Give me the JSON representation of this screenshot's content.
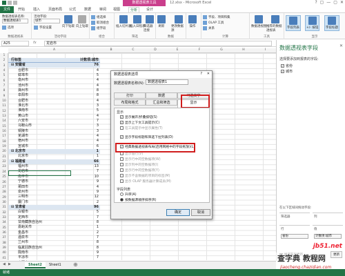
{
  "titlebar": {
    "context_tab": "数据透视表工具",
    "title": "12.xlsx - Microsoft Excel",
    "controls": [
      "?",
      "▢",
      "—",
      "▢",
      "✕"
    ]
  },
  "tabs": [
    "文件",
    "开始",
    "插入",
    "页面布局",
    "公式",
    "数据",
    "审阅",
    "视图",
    "分析",
    "设计"
  ],
  "active_tab": "分析",
  "ribbon": {
    "pivot_name_label": "数据透视表名称:",
    "pivot_name_value": "数据透视表1",
    "options_button": "选项",
    "active_field_label": "活动字段:",
    "active_field_value": "城市",
    "field_settings": "字段设置",
    "group_pivot": "数据透视表",
    "group_active_field": "活动字段",
    "drill_down": "向下钻取",
    "drill_up": "向上钻取",
    "group_selection": "组选择",
    "ungroup": "取消组合",
    "group_field": "组字段",
    "group_group": "组合",
    "insert_slicer": "插入切片器",
    "insert_timeline": "插入日程表",
    "filter_connections": "筛选器连接",
    "group_filter": "筛选",
    "refresh": "刷新",
    "change_source": "更改数据源",
    "group_data": "数据",
    "actions": "操作",
    "calc": "计算",
    "fields_items": "字段、项目和集",
    "olap_tools": "OLAP 工具",
    "relationships": "关系",
    "pivot_chart": "数据透视图",
    "recommended": "推荐的数据透视表",
    "group_tools": "工具",
    "field_list": "字段列表",
    "buttons": "+/- 按钮",
    "headers": "字段标题",
    "group_show": "显示"
  },
  "formula": {
    "namebox": "A25",
    "fx": "fx",
    "value": "龙岩市"
  },
  "columns": [
    "A",
    "B",
    "C",
    "D",
    "E",
    "F",
    "G",
    "H",
    "I"
  ],
  "rows": [
    "1",
    "2",
    "3",
    "4",
    "5",
    "6",
    "7",
    "8",
    "9",
    "10",
    "11",
    "12",
    "13",
    "14",
    "15",
    "16",
    "17",
    "18",
    "19",
    "20",
    "21",
    "22",
    "23",
    "24",
    "25",
    "26",
    "27",
    "28",
    "29",
    "30",
    "31",
    "32",
    "33",
    "34",
    "35",
    "36",
    "37",
    "38",
    "39",
    "40",
    "41"
  ],
  "pivot": {
    "header_label": "行标签",
    "header_value": "计数项:城市",
    "rows": [
      {
        "label": "安徽省",
        "value": "76",
        "type": "prov"
      },
      {
        "label": "合肥市",
        "value": "4",
        "type": "city"
      },
      {
        "label": "蚌埠市",
        "value": "5",
        "type": "city"
      },
      {
        "label": "亳州市",
        "value": "4",
        "type": "city"
      },
      {
        "label": "池州市",
        "value": "4",
        "type": "city"
      },
      {
        "label": "滁州市",
        "value": "8",
        "type": "city"
      },
      {
        "label": "阜阳市",
        "value": "8",
        "type": "city"
      },
      {
        "label": "合肥市",
        "value": "4",
        "type": "city"
      },
      {
        "label": "淮北市",
        "value": "3",
        "type": "city"
      },
      {
        "label": "淮南市",
        "value": "5",
        "type": "city"
      },
      {
        "label": "黄山市",
        "value": "4",
        "type": "city"
      },
      {
        "label": "六安市",
        "value": "7",
        "type": "city"
      },
      {
        "label": "马鞍山市",
        "value": "3",
        "type": "city"
      },
      {
        "label": "铜陵市",
        "value": "3",
        "type": "city"
      },
      {
        "label": "芜湖市",
        "value": "4",
        "type": "city"
      },
      {
        "label": "宿州市",
        "value": "4",
        "type": "city"
      },
      {
        "label": "宣城市",
        "value": "6",
        "type": "city"
      },
      {
        "label": "北京市",
        "value": "1",
        "type": "prov"
      },
      {
        "label": "北京市",
        "value": "1",
        "type": "city"
      },
      {
        "label": "福建省",
        "value": "66",
        "type": "prov"
      },
      {
        "label": "福州市",
        "value": "13",
        "type": "city"
      },
      {
        "label": "龙岩市",
        "value": "7",
        "type": "city"
      },
      {
        "label": "南平市",
        "value": "10",
        "type": "city"
      },
      {
        "label": "宁德市",
        "value": "9",
        "type": "city"
      },
      {
        "label": "莆田市",
        "value": "4",
        "type": "city"
      },
      {
        "label": "泉州市",
        "value": "9",
        "type": "city"
      },
      {
        "label": "三明市",
        "value": "12",
        "type": "city"
      },
      {
        "label": "厦门市",
        "value": "2",
        "type": "city"
      },
      {
        "label": "甘肃省",
        "value": "96",
        "type": "prov"
      },
      {
        "label": "白银市",
        "value": "5",
        "type": "city"
      },
      {
        "label": "定西市",
        "value": "7",
        "type": "city"
      },
      {
        "label": "甘南藏族自治州",
        "value": "8",
        "type": "city"
      },
      {
        "label": "嘉峪关市",
        "value": "1",
        "type": "city"
      },
      {
        "label": "金昌市",
        "value": "2",
        "type": "city"
      },
      {
        "label": "酒泉市",
        "value": "7",
        "type": "city"
      },
      {
        "label": "兰州市",
        "value": "8",
        "type": "city"
      },
      {
        "label": "临夏回族自治州",
        "value": "8",
        "type": "city"
      },
      {
        "label": "陇南市",
        "value": "9",
        "type": "city"
      },
      {
        "label": "平凉市",
        "value": "7",
        "type": "city"
      },
      {
        "label": "庆阳市",
        "value": "8",
        "type": "city"
      }
    ]
  },
  "sheets": [
    "Sheet2",
    "Sheet1"
  ],
  "active_sheet": "Sheet2",
  "status": "就绪",
  "panel": {
    "title": "数据透视表字段",
    "subtitle": "选择要添加到报表的字段:",
    "fields": [
      "省份",
      "城市"
    ],
    "drag_label": "在以下区域间拖动字段:",
    "filter_zone": "筛选器",
    "columns_zone": "列",
    "rows_zone": "行",
    "values_zone": "值",
    "rows_tag": "省份",
    "values_tag": "计数项:城市",
    "defer": "推迟布局更新",
    "update": "更新"
  },
  "dialog": {
    "title": "数据透视表选项",
    "help": "?",
    "close": "✕",
    "name_label": "数据透视表名称(N):",
    "name_value": "数据透视表1",
    "tabs_row1": [
      "打印",
      "数据",
      "可选文字"
    ],
    "tabs_row2": [
      "布局和格式",
      "汇总和筛选",
      "显示"
    ],
    "active_tab": "显示",
    "section_display": "显示",
    "options": [
      {
        "label": "显示展开/折叠按钮(S)",
        "checked": true,
        "disabled": false
      },
      {
        "label": "显示上下文工具提示(C)",
        "checked": true,
        "disabled": false
      },
      {
        "label": "在工具提示中显示属性(T)",
        "checked": false,
        "disabled": true
      },
      {
        "label": "显示字段标题和筛选下拉列表(D)",
        "checked": true,
        "disabled": false
      },
      {
        "label": "经典数据透视表布局(启用网格中的字段拖放)(L)",
        "checked": true,
        "disabled": false
      },
      {
        "label": "显示值行(V)",
        "checked": false,
        "disabled": true
      },
      {
        "label": "显示行中的空数据项(W)",
        "checked": false,
        "disabled": true
      },
      {
        "label": "显示列中的空数据项(I)",
        "checked": false,
        "disabled": true
      },
      {
        "label": "显示行中的空数据项(Y)",
        "checked": false,
        "disabled": true
      },
      {
        "label": "显示不含数据的项目的标签(M)",
        "checked": false,
        "disabled": true
      },
      {
        "label": "显示 OLAP 服务器计算成员(M)",
        "checked": false,
        "disabled": true
      }
    ],
    "section_fieldlist": "字段列表",
    "radio_asc": "升序(A)",
    "radio_source": "按数据源顺序排序(R)",
    "ok": "确定",
    "cancel": "取消"
  },
  "watermark": {
    "line1": "jb51.net",
    "line2": "查字典 教程网",
    "line3": "jiaocheng.chazidian.com"
  }
}
